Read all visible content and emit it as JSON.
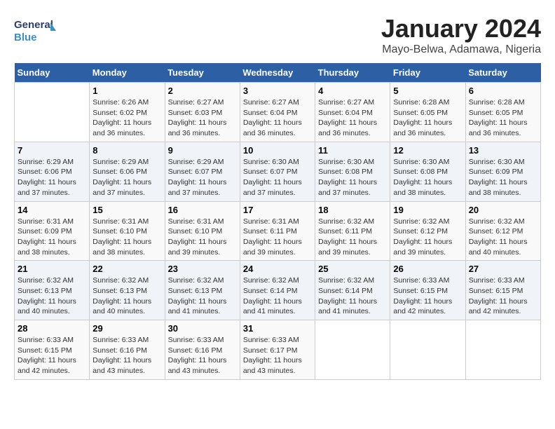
{
  "logo": {
    "general": "General",
    "blue": "Blue"
  },
  "title": "January 2024",
  "subtitle": "Mayo-Belwa, Adamawa, Nigeria",
  "calendar": {
    "headers": [
      "Sunday",
      "Monday",
      "Tuesday",
      "Wednesday",
      "Thursday",
      "Friday",
      "Saturday"
    ],
    "weeks": [
      [
        {
          "day": "",
          "sunrise": "",
          "sunset": "",
          "daylight": ""
        },
        {
          "day": "1",
          "sunrise": "Sunrise: 6:26 AM",
          "sunset": "Sunset: 6:02 PM",
          "daylight": "Daylight: 11 hours and 36 minutes."
        },
        {
          "day": "2",
          "sunrise": "Sunrise: 6:27 AM",
          "sunset": "Sunset: 6:03 PM",
          "daylight": "Daylight: 11 hours and 36 minutes."
        },
        {
          "day": "3",
          "sunrise": "Sunrise: 6:27 AM",
          "sunset": "Sunset: 6:04 PM",
          "daylight": "Daylight: 11 hours and 36 minutes."
        },
        {
          "day": "4",
          "sunrise": "Sunrise: 6:27 AM",
          "sunset": "Sunset: 6:04 PM",
          "daylight": "Daylight: 11 hours and 36 minutes."
        },
        {
          "day": "5",
          "sunrise": "Sunrise: 6:28 AM",
          "sunset": "Sunset: 6:05 PM",
          "daylight": "Daylight: 11 hours and 36 minutes."
        },
        {
          "day": "6",
          "sunrise": "Sunrise: 6:28 AM",
          "sunset": "Sunset: 6:05 PM",
          "daylight": "Daylight: 11 hours and 36 minutes."
        }
      ],
      [
        {
          "day": "7",
          "sunrise": "Sunrise: 6:29 AM",
          "sunset": "Sunset: 6:06 PM",
          "daylight": "Daylight: 11 hours and 37 minutes."
        },
        {
          "day": "8",
          "sunrise": "Sunrise: 6:29 AM",
          "sunset": "Sunset: 6:06 PM",
          "daylight": "Daylight: 11 hours and 37 minutes."
        },
        {
          "day": "9",
          "sunrise": "Sunrise: 6:29 AM",
          "sunset": "Sunset: 6:07 PM",
          "daylight": "Daylight: 11 hours and 37 minutes."
        },
        {
          "day": "10",
          "sunrise": "Sunrise: 6:30 AM",
          "sunset": "Sunset: 6:07 PM",
          "daylight": "Daylight: 11 hours and 37 minutes."
        },
        {
          "day": "11",
          "sunrise": "Sunrise: 6:30 AM",
          "sunset": "Sunset: 6:08 PM",
          "daylight": "Daylight: 11 hours and 37 minutes."
        },
        {
          "day": "12",
          "sunrise": "Sunrise: 6:30 AM",
          "sunset": "Sunset: 6:08 PM",
          "daylight": "Daylight: 11 hours and 38 minutes."
        },
        {
          "day": "13",
          "sunrise": "Sunrise: 6:30 AM",
          "sunset": "Sunset: 6:09 PM",
          "daylight": "Daylight: 11 hours and 38 minutes."
        }
      ],
      [
        {
          "day": "14",
          "sunrise": "Sunrise: 6:31 AM",
          "sunset": "Sunset: 6:09 PM",
          "daylight": "Daylight: 11 hours and 38 minutes."
        },
        {
          "day": "15",
          "sunrise": "Sunrise: 6:31 AM",
          "sunset": "Sunset: 6:10 PM",
          "daylight": "Daylight: 11 hours and 38 minutes."
        },
        {
          "day": "16",
          "sunrise": "Sunrise: 6:31 AM",
          "sunset": "Sunset: 6:10 PM",
          "daylight": "Daylight: 11 hours and 39 minutes."
        },
        {
          "day": "17",
          "sunrise": "Sunrise: 6:31 AM",
          "sunset": "Sunset: 6:11 PM",
          "daylight": "Daylight: 11 hours and 39 minutes."
        },
        {
          "day": "18",
          "sunrise": "Sunrise: 6:32 AM",
          "sunset": "Sunset: 6:11 PM",
          "daylight": "Daylight: 11 hours and 39 minutes."
        },
        {
          "day": "19",
          "sunrise": "Sunrise: 6:32 AM",
          "sunset": "Sunset: 6:12 PM",
          "daylight": "Daylight: 11 hours and 39 minutes."
        },
        {
          "day": "20",
          "sunrise": "Sunrise: 6:32 AM",
          "sunset": "Sunset: 6:12 PM",
          "daylight": "Daylight: 11 hours and 40 minutes."
        }
      ],
      [
        {
          "day": "21",
          "sunrise": "Sunrise: 6:32 AM",
          "sunset": "Sunset: 6:13 PM",
          "daylight": "Daylight: 11 hours and 40 minutes."
        },
        {
          "day": "22",
          "sunrise": "Sunrise: 6:32 AM",
          "sunset": "Sunset: 6:13 PM",
          "daylight": "Daylight: 11 hours and 40 minutes."
        },
        {
          "day": "23",
          "sunrise": "Sunrise: 6:32 AM",
          "sunset": "Sunset: 6:13 PM",
          "daylight": "Daylight: 11 hours and 41 minutes."
        },
        {
          "day": "24",
          "sunrise": "Sunrise: 6:32 AM",
          "sunset": "Sunset: 6:14 PM",
          "daylight": "Daylight: 11 hours and 41 minutes."
        },
        {
          "day": "25",
          "sunrise": "Sunrise: 6:32 AM",
          "sunset": "Sunset: 6:14 PM",
          "daylight": "Daylight: 11 hours and 41 minutes."
        },
        {
          "day": "26",
          "sunrise": "Sunrise: 6:33 AM",
          "sunset": "Sunset: 6:15 PM",
          "daylight": "Daylight: 11 hours and 42 minutes."
        },
        {
          "day": "27",
          "sunrise": "Sunrise: 6:33 AM",
          "sunset": "Sunset: 6:15 PM",
          "daylight": "Daylight: 11 hours and 42 minutes."
        }
      ],
      [
        {
          "day": "28",
          "sunrise": "Sunrise: 6:33 AM",
          "sunset": "Sunset: 6:15 PM",
          "daylight": "Daylight: 11 hours and 42 minutes."
        },
        {
          "day": "29",
          "sunrise": "Sunrise: 6:33 AM",
          "sunset": "Sunset: 6:16 PM",
          "daylight": "Daylight: 11 hours and 43 minutes."
        },
        {
          "day": "30",
          "sunrise": "Sunrise: 6:33 AM",
          "sunset": "Sunset: 6:16 PM",
          "daylight": "Daylight: 11 hours and 43 minutes."
        },
        {
          "day": "31",
          "sunrise": "Sunrise: 6:33 AM",
          "sunset": "Sunset: 6:17 PM",
          "daylight": "Daylight: 11 hours and 43 minutes."
        },
        {
          "day": "",
          "sunrise": "",
          "sunset": "",
          "daylight": ""
        },
        {
          "day": "",
          "sunrise": "",
          "sunset": "",
          "daylight": ""
        },
        {
          "day": "",
          "sunrise": "",
          "sunset": "",
          "daylight": ""
        }
      ]
    ]
  }
}
